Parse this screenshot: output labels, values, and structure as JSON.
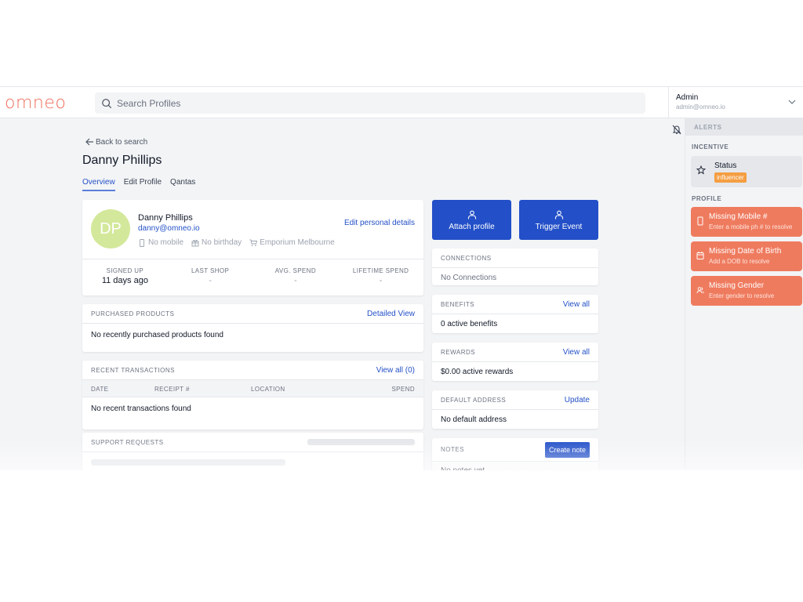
{
  "header": {
    "logo": "omneo",
    "search_placeholder": "Search Profiles",
    "user": {
      "name": "Admin",
      "email": "admin@omneo.io"
    }
  },
  "alerts": {
    "title": "ALERTS",
    "incentive_section": "INCENTIVE",
    "incentive": {
      "title": "Status",
      "badge": "influencer"
    },
    "profile_section": "PROFILE",
    "items": [
      {
        "title": "Missing Mobile #",
        "subtitle": "Enter a mobile ph # to resolve",
        "icon": "mobile-icon"
      },
      {
        "title": "Missing Date of Birth",
        "subtitle": "Add a DOB to resolve",
        "icon": "calendar-icon"
      },
      {
        "title": "Missing Gender",
        "subtitle": "Enter gender to resolve",
        "icon": "users-icon"
      }
    ],
    "colors": {
      "alert": "#ef7b5f",
      "badge": "#f59e42"
    }
  },
  "page": {
    "back_label": "Back to search",
    "title": "Danny Phillips",
    "tabs": [
      {
        "label": "Overview",
        "active": true
      },
      {
        "label": "Edit Profile",
        "active": false
      },
      {
        "label": "Qantas",
        "active": false
      }
    ]
  },
  "profile": {
    "initials": "DP",
    "name": "Danny Phillips",
    "email": "danny@omneo.io",
    "mobile": "No mobile",
    "birthday": "No birthday",
    "store": "Emporium Melbourne",
    "edit_link": "Edit personal details",
    "stats": [
      {
        "label": "SIGNED UP",
        "value": "11 days ago"
      },
      {
        "label": "LAST SHOP",
        "value": "-"
      },
      {
        "label": "AVG. SPEND",
        "value": "-"
      },
      {
        "label": "LIFETIME SPEND",
        "value": "-"
      }
    ]
  },
  "products": {
    "label": "PURCHASED PRODUCTS",
    "link": "Detailed View",
    "empty": "No recently purchased products found"
  },
  "transactions": {
    "label": "RECENT TRANSACTIONS",
    "link": "View all (0)",
    "columns": [
      "DATE",
      "RECEIPT #",
      "LOCATION",
      "SPEND"
    ],
    "empty": "No recent transactions found"
  },
  "support": {
    "label": "SUPPORT REQUESTS"
  },
  "actions": {
    "attach": "Attach profile",
    "trigger": "Trigger Event"
  },
  "connections": {
    "label": "CONNECTIONS",
    "empty": "No Connections"
  },
  "benefits": {
    "label": "BENEFITS",
    "link": "View all",
    "value": "0 active benefits"
  },
  "rewards": {
    "label": "REWARDS",
    "link": "View all",
    "value": "$0.00 active rewards"
  },
  "address": {
    "label": "DEFAULT ADDRESS",
    "link": "Update",
    "value": "No default address"
  },
  "notes": {
    "label": "NOTES",
    "button": "Create note",
    "empty": "No notes yet"
  },
  "colors": {
    "primary": "#2350c8",
    "brand": "#ef6f5e",
    "avatar": "#d3e89a"
  }
}
